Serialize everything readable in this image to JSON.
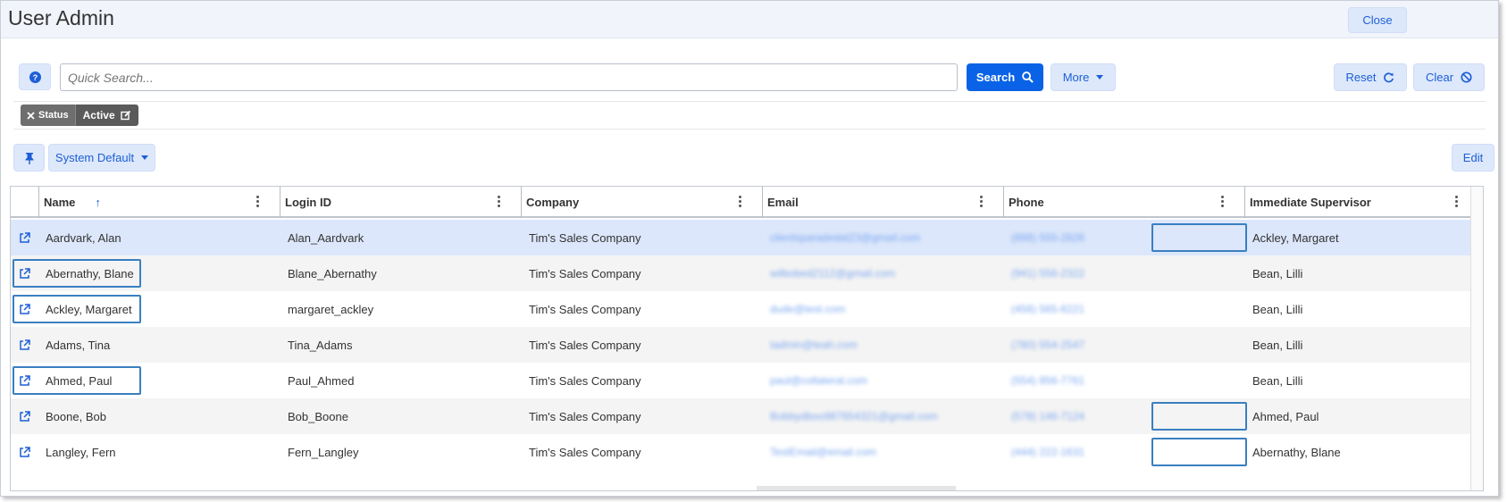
{
  "window": {
    "title": "User Admin",
    "close_label": "Close"
  },
  "toolbar": {
    "help_icon": "question-circle-icon",
    "search_placeholder": "Quick Search...",
    "search_label": "Search",
    "more_label": "More",
    "reset_label": "Reset",
    "clear_label": "Clear"
  },
  "filter": {
    "chip_label": "Status",
    "chip_value": "Active"
  },
  "view": {
    "pin_icon": "pin-icon",
    "layout_label": "System Default",
    "edit_label": "Edit"
  },
  "grid": {
    "columns": [
      "Name",
      "Login ID",
      "Company",
      "Email",
      "Phone",
      "Immediate Supervisor"
    ],
    "sort_indicator": "↑",
    "rows": [
      {
        "name": "Aardvark, Alan",
        "login": "Alan_Aardvark",
        "company": "Tim's Sales Company",
        "email": "clientsparadedat23@gmail.com",
        "phone": "(888) 555-2826",
        "supervisor": "Ackley, Margaret"
      },
      {
        "name": "Abernathy, Blane",
        "login": "Blane_Abernathy",
        "company": "Tim's Sales Company",
        "email": "wilbobed2112@gmail.com",
        "phone": "(941) 556-2322",
        "supervisor": "Bean, Lilli"
      },
      {
        "name": "Ackley, Margaret",
        "login": "margaret_ackley",
        "company": "Tim's Sales Company",
        "email": "dude@test.com",
        "phone": "(456) 565-6221",
        "supervisor": "Bean, Lilli"
      },
      {
        "name": "Adams, Tina",
        "login": "Tina_Adams",
        "company": "Tim's Sales Company",
        "email": "tadmin@teah.com",
        "phone": "(780) 554-2547",
        "supervisor": "Bean, Lilli"
      },
      {
        "name": "Ahmed, Paul",
        "login": "Paul_Ahmed",
        "company": "Tim's Sales Company",
        "email": "paul@collateral.com",
        "phone": "(554) 856-7761",
        "supervisor": "Bean, Lilli"
      },
      {
        "name": "Boone, Bob",
        "login": "Bob_Boone",
        "company": "Tim's Sales Company",
        "email": "Bobbydboo987654321@gmail.com",
        "phone": "(578) 146-7124",
        "supervisor": "Ahmed, Paul"
      },
      {
        "name": "Langley, Fern",
        "login": "Fern_Langley",
        "company": "Tim's Sales Company",
        "email": "TestEmail@email.com",
        "phone": "(444) 222-1631",
        "supervisor": "Abernathy, Blane"
      }
    ]
  },
  "colors": {
    "accent": "#0a63e6",
    "soft_button": "#dde8fb",
    "selected_row": "#dce7fb",
    "highlight_box": "#3a7fc1"
  }
}
